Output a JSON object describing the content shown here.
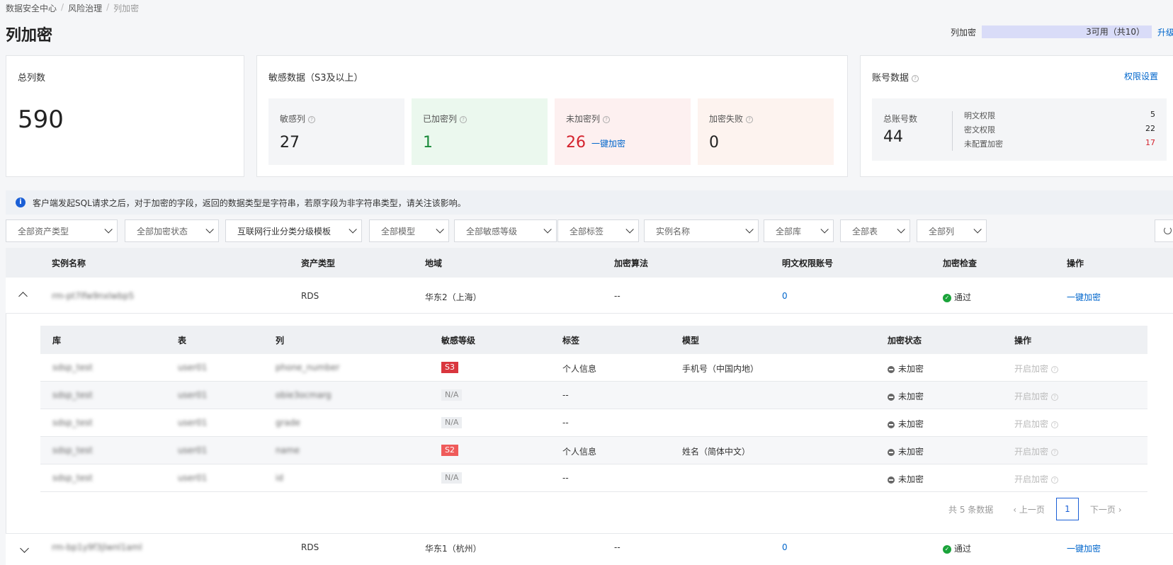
{
  "breadcrumb": [
    "数据安全中心",
    "风险治理",
    "列加密"
  ],
  "page_title": "列加密",
  "quota": {
    "label": "列加密",
    "text": "3可用（共10）",
    "used_fraction": 0.7,
    "link": "升级"
  },
  "total_card": {
    "title": "总列数",
    "value": "590"
  },
  "sensitive_card": {
    "title": "敏感数据（S3及以上）",
    "items": [
      {
        "label": "敏感列",
        "value": "27",
        "bg": "#f4f5f7",
        "color": "#222"
      },
      {
        "label": "已加密列",
        "value": "1",
        "bg": "#ebf8ee",
        "color": "#1a8a3a"
      },
      {
        "label": "未加密列",
        "value": "26",
        "bg": "#fdf0f0",
        "color": "#d4232e",
        "action": "一键加密"
      },
      {
        "label": "加密失败",
        "value": "0",
        "bg": "#fdf3ef",
        "color": "#222"
      }
    ]
  },
  "account_card": {
    "title": "账号数据",
    "link": "权限设置",
    "total_label": "总账号数",
    "total_value": "44",
    "details": [
      {
        "label": "明文权限",
        "value": "5",
        "color": "#222"
      },
      {
        "label": "密文权限",
        "value": "22",
        "color": "#222"
      },
      {
        "label": "未配置加密",
        "value": "17",
        "color": "#d4232e"
      }
    ]
  },
  "notice": "客户端发起SQL请求之后，对于加密的字段，返回的数据类型是字符串，若原字段为非字符串类型，请关注该影响。",
  "filters": [
    "全部资产类型",
    "全部加密状态",
    "互联网行业分类分级模板",
    "全部模型",
    "全部敏感等级",
    "全部标签",
    "实例名称",
    "全部库",
    "全部表",
    "全部列"
  ],
  "table_headers": [
    "实例名称",
    "资产类型",
    "地域",
    "加密算法",
    "明文权限账号",
    "加密检查",
    "操作"
  ],
  "instances": [
    {
      "name": "rm-pt7lfw9nxlwbp5",
      "type": "RDS",
      "region": "华东2（上海）",
      "algo": "--",
      "accounts": "0",
      "check": "通过",
      "action": "一键加密"
    },
    {
      "name": "rm-bp1y9f3jlwnl1aml",
      "type": "RDS",
      "region": "华东1（杭州）",
      "algo": "--",
      "accounts": "0",
      "check": "通过",
      "action": "一键加密"
    }
  ],
  "inner_headers": [
    "库",
    "表",
    "列",
    "敏感等级",
    "标签",
    "模型",
    "加密状态",
    "操作"
  ],
  "inner_rows": [
    {
      "db": "sdsp_test",
      "table": "user01",
      "col": "phone_number",
      "level": "S3",
      "tag": "个人信息",
      "model": "手机号（中国内地）",
      "status": "未加密",
      "op": "开启加密"
    },
    {
      "db": "sdsp_test",
      "table": "user01",
      "col": "obie3ocmarg",
      "level": "N/A",
      "tag": "--",
      "model": "",
      "status": "未加密",
      "op": "开启加密"
    },
    {
      "db": "sdsp_test",
      "table": "user01",
      "col": "grade",
      "level": "N/A",
      "tag": "--",
      "model": "",
      "status": "未加密",
      "op": "开启加密"
    },
    {
      "db": "sdsp_test",
      "table": "user01",
      "col": "name",
      "level": "S2",
      "tag": "个人信息",
      "model": "姓名（简体中文）",
      "status": "未加密",
      "op": "开启加密"
    },
    {
      "db": "sdsp_test",
      "table": "user01",
      "col": "id",
      "level": "N/A",
      "tag": "--",
      "model": "",
      "status": "未加密",
      "op": "开启加密"
    }
  ],
  "pager": {
    "total": "共 5 条数据",
    "prev": "上一页",
    "page": "1",
    "next": "下一页"
  }
}
